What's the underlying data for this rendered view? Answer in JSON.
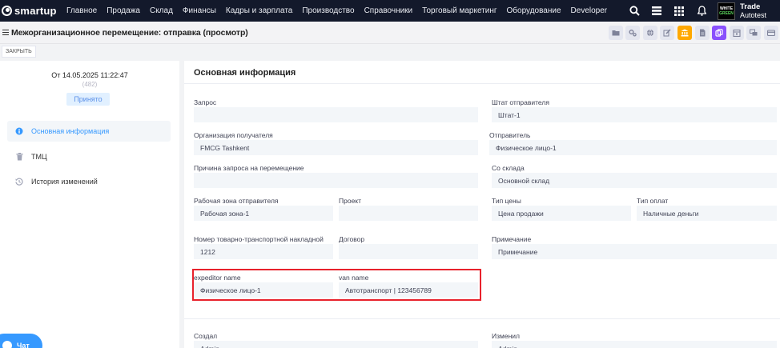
{
  "app": {
    "logo": "smartup",
    "nav": [
      "Главное",
      "Продажа",
      "Склад",
      "Финансы",
      "Кадры и зарплата",
      "Производство",
      "Справочники",
      "Торговый маркетинг",
      "Оборудование",
      "Developer"
    ],
    "badge_line1": "WHITE",
    "badge_line2": "GREEN",
    "user_name": "Trade",
    "user_org": "Autotest"
  },
  "header": {
    "title": "Межорганизационное перемещение: отправка (просмотр)",
    "close_label": "ЗАКРЫТЬ",
    "action_icons": [
      "folder-icon",
      "gears-icon",
      "globe-icon",
      "edit-icon",
      "bank-icon",
      "document-icon",
      "copy-icon",
      "calendar-icon",
      "chat-icon",
      "credit-card-icon"
    ]
  },
  "sidebar": {
    "date": "От 14.05.2025 11:22:47",
    "number": "(482)",
    "status": "Принято",
    "items": [
      {
        "label": "Основная информация",
        "icon": "info-icon",
        "active": true
      },
      {
        "label": "ТМЦ",
        "icon": "trash-icon",
        "active": false
      },
      {
        "label": "История изменений",
        "icon": "history-icon",
        "active": false
      }
    ],
    "chat_label": "Чат"
  },
  "main": {
    "title": "Основная информация",
    "fields": {
      "request": {
        "label": "Запрос",
        "value": ""
      },
      "sender_staff": {
        "label": "Штат отправителя",
        "value": "Штат-1"
      },
      "receiver_org": {
        "label": "Организация получателя",
        "value": "FMCG Tashkent"
      },
      "sender": {
        "label": "Отправитель",
        "value": "Физическое лицо-1"
      },
      "move_reason": {
        "label": "Причина запроса на перемещение",
        "value": ""
      },
      "from_warehouse": {
        "label": "Со склада",
        "value": "Основной склад"
      },
      "sender_zone": {
        "label": "Рабочая зона отправителя",
        "value": "Рабочая зона-1"
      },
      "project": {
        "label": "Проект",
        "value": ""
      },
      "price_type": {
        "label": "Тип цены",
        "value": "Цена продажи"
      },
      "payment_type": {
        "label": "Тип оплат",
        "value": "Наличные деньги"
      },
      "waybill": {
        "label": "Номер товарно-транспортной накладной",
        "value": "1212"
      },
      "contract": {
        "label": "Договор",
        "value": ""
      },
      "note": {
        "label": "Примечание",
        "value": "Примечание"
      },
      "expeditor": {
        "label": "expeditor name",
        "value": "Физическое лицо-1"
      },
      "van": {
        "label": "van name",
        "value": "Автотранспорт | 123456789"
      },
      "created_by": {
        "label": "Создал",
        "value": "Admin"
      },
      "modified_by": {
        "label": "Изменил",
        "value": "Admin"
      }
    }
  },
  "colors": {
    "accent": "#3699ff",
    "highlight": "#e8222c",
    "nav_bg": "#13192b"
  }
}
